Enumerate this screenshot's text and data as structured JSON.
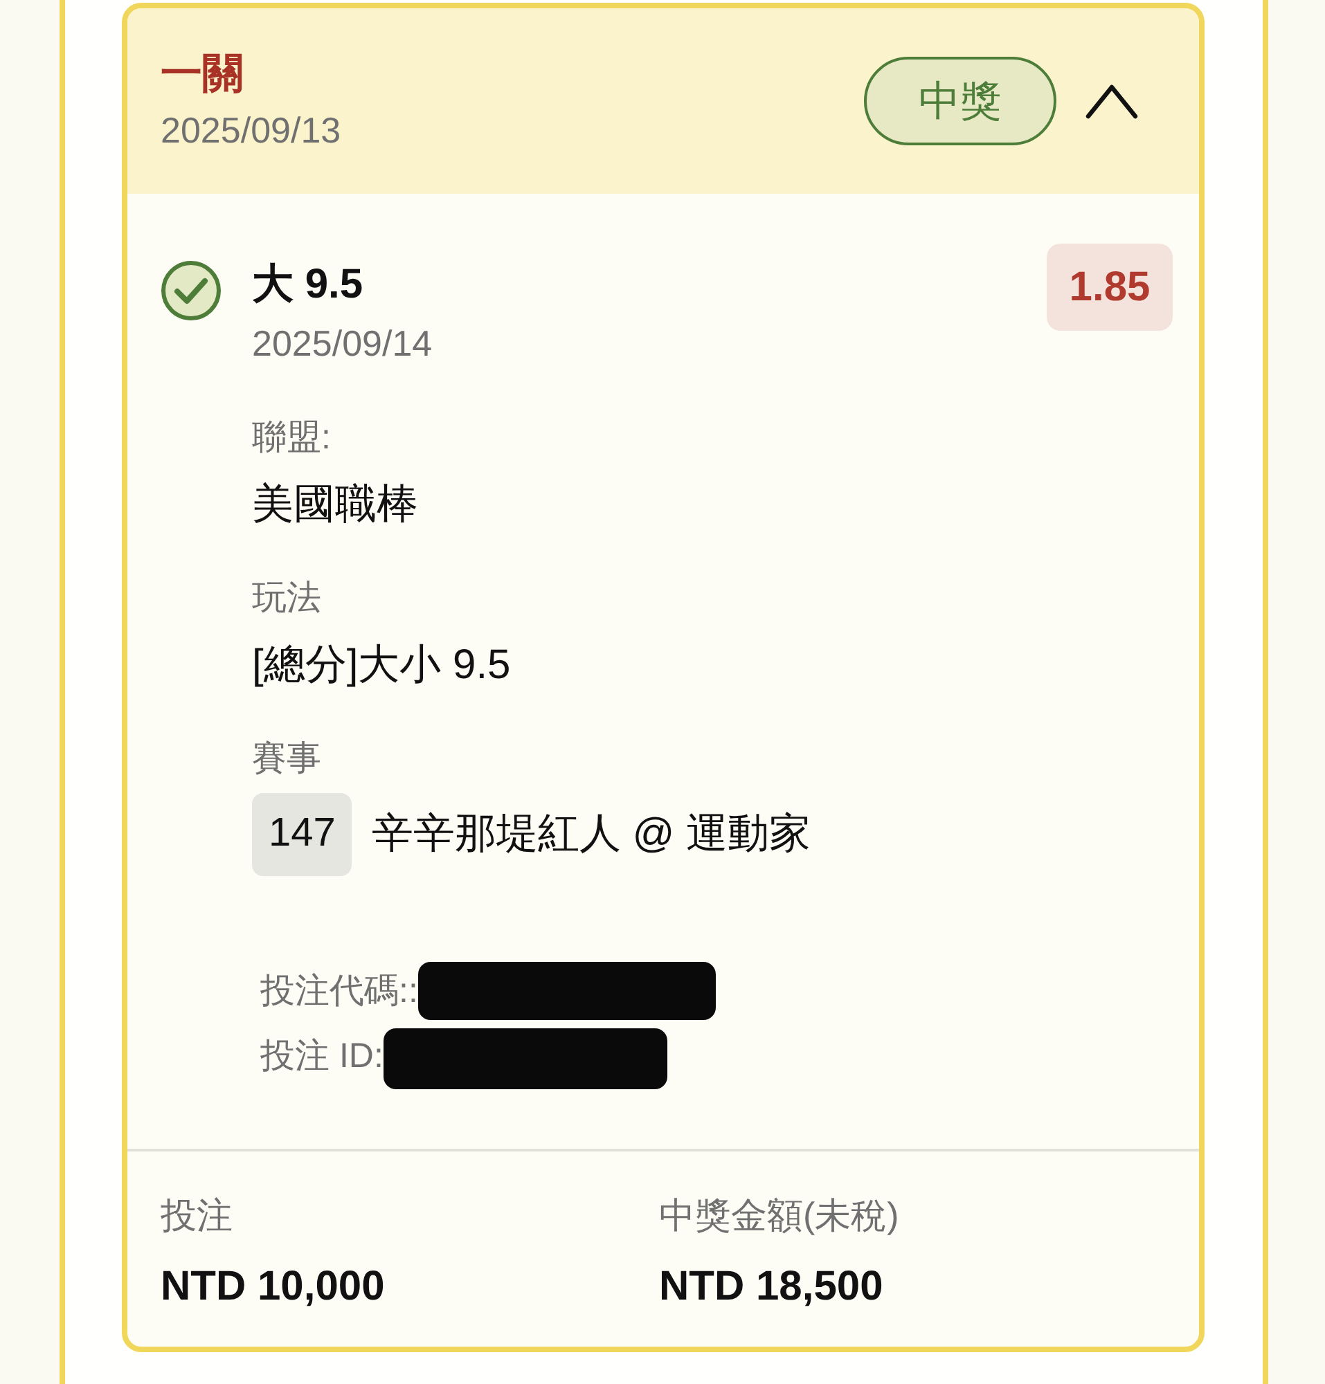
{
  "bet_card": {
    "title": "一關",
    "date": "2025/09/13",
    "status_badge": "中獎",
    "expanded": true,
    "selections": [
      {
        "won": true,
        "pick": "大 9.5",
        "date": "2025/09/14",
        "odds": "1.85",
        "fields": [
          {
            "kind": "text",
            "label": "聯盟:",
            "value": "美國職棒"
          },
          {
            "kind": "text",
            "label": "玩法",
            "value": "[總分]大小 9.5"
          },
          {
            "kind": "match",
            "label": "賽事",
            "number": "147",
            "value": "辛辛那堤紅人 @ 運動家"
          }
        ],
        "references": [
          {
            "label": "投注代碼::",
            "redacted": true
          },
          {
            "label": "投注 ID:",
            "redacted": true
          }
        ]
      }
    ],
    "totals": [
      {
        "label": "投注",
        "value": "NTD 10,000"
      },
      {
        "label": "中獎金額(未稅)",
        "value": "NTD 18,500"
      }
    ]
  }
}
